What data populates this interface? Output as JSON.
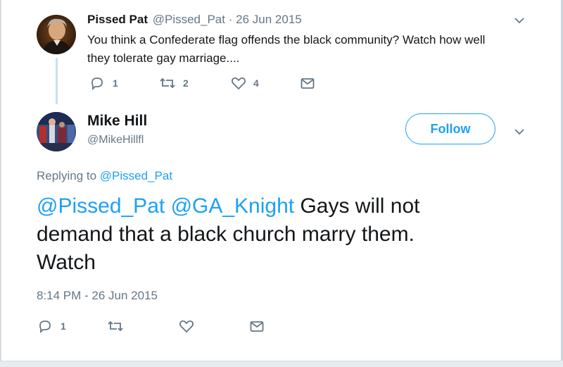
{
  "parent_tweet": {
    "name": "Pissed Pat",
    "handle": "@Pissed_Pat",
    "separator": "·",
    "date": "26 Jun 2015",
    "text_line1": "You think a Confederate flag offends the black community? Watch how well",
    "text_line2": "they tolerate gay marriage....",
    "replies": "1",
    "retweets": "2",
    "likes": "4"
  },
  "main_tweet": {
    "name": "Mike Hill",
    "handle": "@MikeHillfl",
    "follow_label": "Follow",
    "replying_prefix": "Replying to",
    "replying_to": "@Pissed_Pat",
    "mention1": "@Pissed_Pat",
    "mention2": "@GA_Knight",
    "text_line1_rest": "Gays will not",
    "text_line2": "demand that a black church marry them.",
    "text_line3": "Watch",
    "timestamp": "8:14 PM - 26 Jun 2015",
    "replies": "1"
  },
  "icons": {
    "reply": "reply-icon",
    "retweet": "retweet-icon",
    "like": "heart-icon",
    "dm": "envelope-icon",
    "menu": "chevron-down-icon"
  },
  "colors": {
    "accent": "#1da1f2",
    "muted": "#657786",
    "text": "#14171a",
    "thread_line": "#c4e1f5"
  }
}
